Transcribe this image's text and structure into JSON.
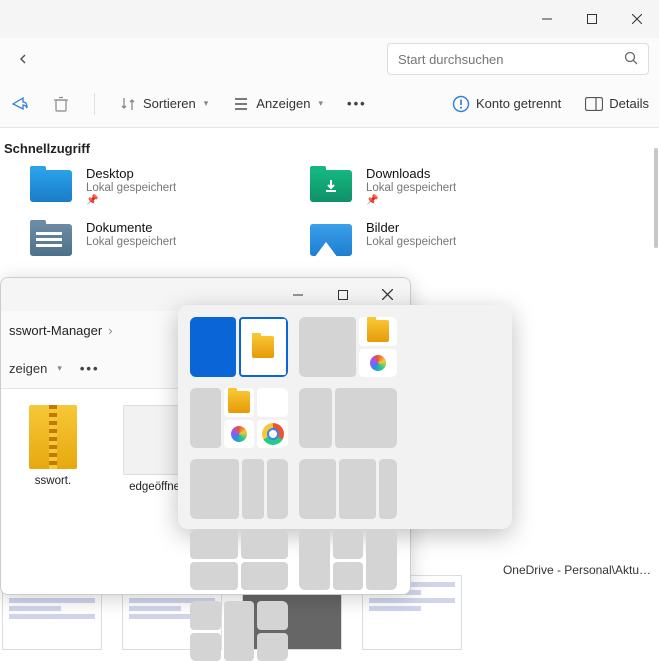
{
  "bg_window": {
    "search_placeholder": "Start durchsuchen",
    "toolbar": {
      "sort": "Sortieren",
      "view": "Anzeigen",
      "account": "Konto getrennt",
      "details": "Details"
    },
    "section_header": "Schnellzugriff",
    "quick_access": [
      {
        "name": "Desktop",
        "sub": "Lokal gespeichert",
        "icon": "desktop"
      },
      {
        "name": "Downloads",
        "sub": "Lokal gespeichert",
        "icon": "downloads"
      },
      {
        "name": "Dokumente",
        "sub": "Lokal gespeichert",
        "icon": "documents"
      },
      {
        "name": "Bilder",
        "sub": "Lokal gespeichert",
        "icon": "pictures"
      }
    ]
  },
  "fg_window": {
    "breadcrumb": "sswort-Manager",
    "toolbar": {
      "view": "zeigen"
    },
    "files": [
      {
        "name": "sswort.",
        "type": "zip"
      },
      {
        "name": "edgeöffnen.png",
        "type": "image"
      }
    ]
  },
  "taskbar_peek": "OneDrive - Personal\\Aktu…"
}
